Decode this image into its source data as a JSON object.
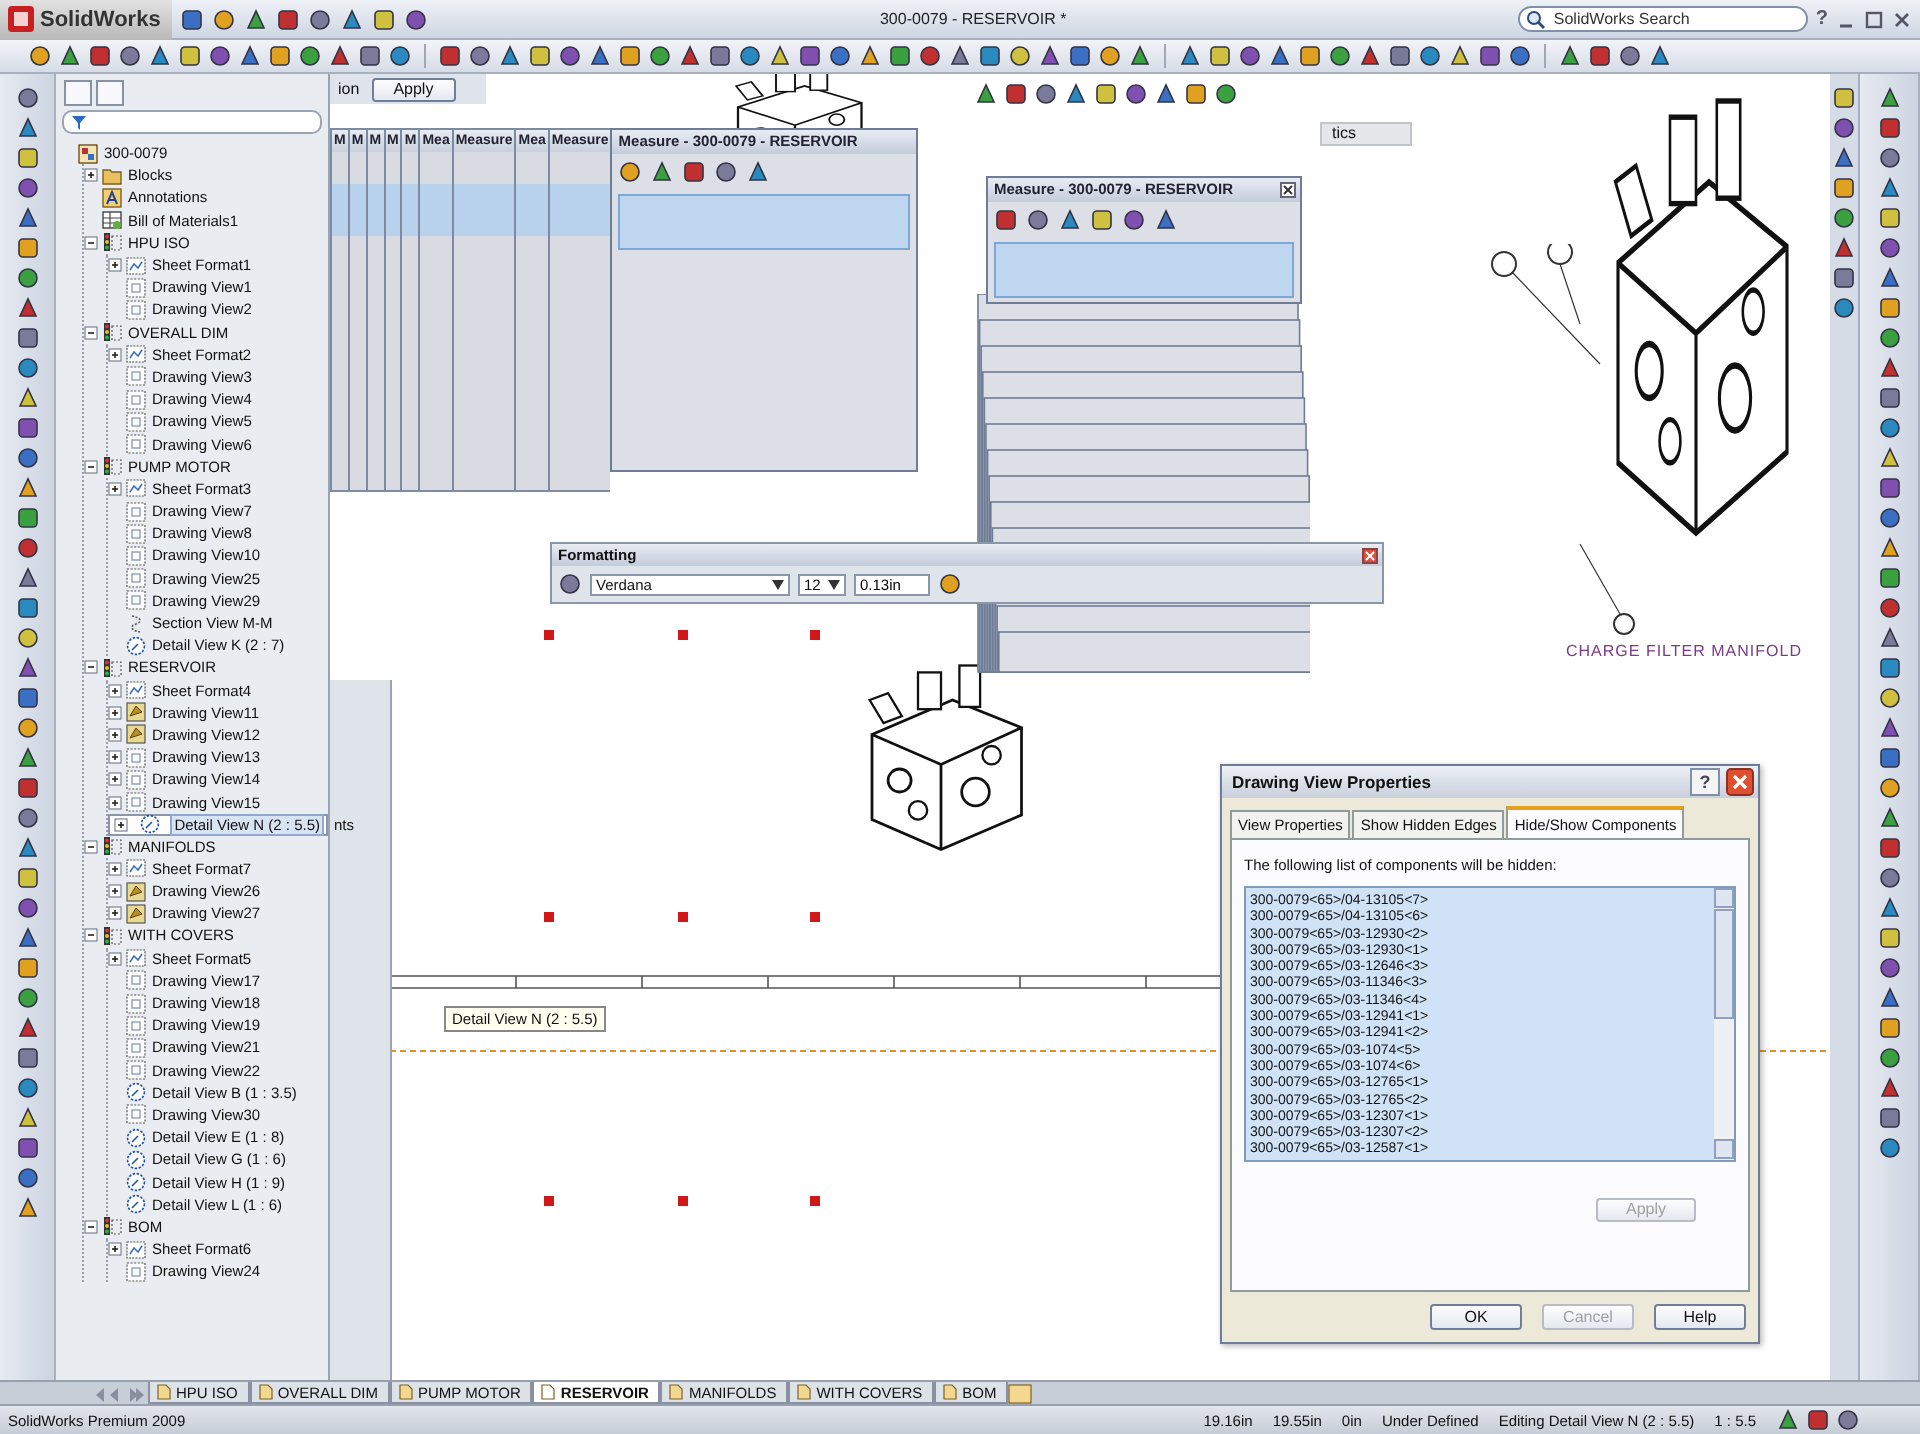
{
  "title_bar": {
    "logo": "SolidWorks",
    "document_title": "300-0079 - RESERVOIR *",
    "search": {
      "placeholder": "SolidWorks Search"
    },
    "help_glyph": "?"
  },
  "property_panel": {
    "label": "ion",
    "apply": "Apply"
  },
  "feature_tree": {
    "items": [
      {
        "label": "300-0079",
        "kind": "drawing",
        "selected": false,
        "children": [
          {
            "label": "Blocks",
            "kind": "folder",
            "expanded": false,
            "selected": false
          },
          {
            "label": "Annotations",
            "kind": "annotations",
            "selected": false
          },
          {
            "label": "Bill of Materials1",
            "kind": "bom",
            "selected": false
          },
          {
            "label": "HPU ISO",
            "kind": "sheet",
            "expanded": true,
            "selected": false,
            "children": [
              {
                "label": "Sheet Format1",
                "kind": "format",
                "expanded": false,
                "selected": false
              },
              {
                "label": "Drawing View1",
                "kind": "view",
                "selected": false
              },
              {
                "label": "Drawing View2",
                "kind": "view",
                "selected": false
              }
            ]
          },
          {
            "label": "OVERALL DIM",
            "kind": "sheet",
            "expanded": true,
            "selected": false,
            "children": [
              {
                "label": "Sheet Format2",
                "kind": "format",
                "expanded": false,
                "selected": false
              },
              {
                "label": "Drawing View3",
                "kind": "view",
                "selected": false
              },
              {
                "label": "Drawing View4",
                "kind": "view",
                "selected": false
              },
              {
                "label": "Drawing View5",
                "kind": "view",
                "selected": false
              },
              {
                "label": "Drawing View6",
                "kind": "view",
                "selected": false
              }
            ]
          },
          {
            "label": "PUMP MOTOR",
            "kind": "sheet",
            "expanded": true,
            "selected": false,
            "children": [
              {
                "label": "Sheet Format3",
                "kind": "format",
                "expanded": false,
                "selected": false
              },
              {
                "label": "Drawing View7",
                "kind": "view",
                "selected": false
              },
              {
                "label": "Drawing View8",
                "kind": "view",
                "selected": false
              },
              {
                "label": "Drawing View10",
                "kind": "view",
                "selected": false
              },
              {
                "label": "Drawing View25",
                "kind": "view",
                "selected": false
              },
              {
                "label": "Drawing View29",
                "kind": "view",
                "selected": false
              },
              {
                "label": "Section View M-M",
                "kind": "section",
                "selected": false
              },
              {
                "label": "Detail View K (2 : 7)",
                "kind": "detail",
                "selected": false
              }
            ]
          },
          {
            "label": "RESERVOIR",
            "kind": "sheet",
            "expanded": true,
            "selected": false,
            "children": [
              {
                "label": "Sheet Format4",
                "kind": "format",
                "expanded": false,
                "selected": false
              },
              {
                "label": "Drawing View11",
                "kind": "model",
                "expanded": false,
                "selected": false
              },
              {
                "label": "Drawing View12",
                "kind": "model",
                "expanded": false,
                "selected": false
              },
              {
                "label": "Drawing View13",
                "kind": "view",
                "expanded": false,
                "selected": false
              },
              {
                "label": "Drawing View14",
                "kind": "view",
                "expanded": false,
                "selected": false
              },
              {
                "label": "Drawing View15",
                "kind": "view",
                "expanded": false,
                "selected": false
              },
              {
                "label": "Detail View N (2 : 5.5)",
                "kind": "detail",
                "expanded": false,
                "selected": true
              }
            ]
          },
          {
            "label": "MANIFOLDS",
            "kind": "sheet",
            "expanded": true,
            "selected": false,
            "children": [
              {
                "label": "Sheet Format7",
                "kind": "format",
                "expanded": false,
                "selected": false
              },
              {
                "label": "Drawing View26",
                "kind": "model",
                "expanded": false,
                "selected": false
              },
              {
                "label": "Drawing View27",
                "kind": "model",
                "expanded": false,
                "selected": false
              }
            ]
          },
          {
            "label": "WITH COVERS",
            "kind": "sheet",
            "expanded": true,
            "selected": false,
            "children": [
              {
                "label": "Sheet Format5",
                "kind": "format",
                "expanded": false,
                "selected": false
              },
              {
                "label": "Drawing View17",
                "kind": "view",
                "selected": false
              },
              {
                "label": "Drawing View18",
                "kind": "view",
                "selected": false
              },
              {
                "label": "Drawing View19",
                "kind": "view",
                "selected": false
              },
              {
                "label": "Drawing View21",
                "kind": "view",
                "selected": false
              },
              {
                "label": "Drawing View22",
                "kind": "view",
                "selected": false
              },
              {
                "label": "Detail View B (1 : 3.5)",
                "kind": "detail",
                "selected": false
              },
              {
                "label": "Drawing View30",
                "kind": "view",
                "selected": false
              },
              {
                "label": "Detail View E (1 : 8)",
                "kind": "detail",
                "selected": false
              },
              {
                "label": "Detail View G (1 : 6)",
                "kind": "detail",
                "selected": false
              },
              {
                "label": "Detail View H (1 : 9)",
                "kind": "detail",
                "selected": false
              },
              {
                "label": "Detail View L (1 : 6)",
                "kind": "detail",
                "selected": false
              }
            ]
          },
          {
            "label": "BOM",
            "kind": "sheet",
            "expanded": true,
            "selected": false,
            "children": [
              {
                "label": "Sheet Format6",
                "kind": "format",
                "expanded": false,
                "selected": false
              },
              {
                "label": "Drawing View24",
                "kind": "view",
                "selected": false
              }
            ]
          }
        ]
      }
    ]
  },
  "measure_stack": [
    {
      "title": "M"
    },
    {
      "title": "M"
    },
    {
      "title": "M"
    },
    {
      "title": "M"
    },
    {
      "title": "M"
    },
    {
      "title": "Mea"
    },
    {
      "title": "Measure"
    },
    {
      "title": "Mea"
    },
    {
      "title": "Measure"
    }
  ],
  "measure_windows": [
    {
      "title": "Measure - 300-0079 - RESERVOIR"
    },
    {
      "title": "Measure - 300-0079 - RESERVOIR"
    }
  ],
  "hidden_panel": {
    "label": "tics"
  },
  "side_panel": {
    "label": "nts"
  },
  "formatting": {
    "title": "Formatting",
    "font": "Verdana",
    "size": "12",
    "height": "0.13in"
  },
  "drawing": {
    "label": "CHARGE FILTER MANIFOLD",
    "tooltip": "Detail View N (2 : 5.5)"
  },
  "dialog": {
    "title": "Drawing View Properties",
    "help_glyph": "?",
    "tabs": [
      {
        "label": "View Properties",
        "selected": false
      },
      {
        "label": "Show Hidden Edges",
        "selected": false
      },
      {
        "label": "Hide/Show Components",
        "selected": true
      }
    ],
    "prompt": "The following list of components will be hidden:",
    "components": [
      "300-0079<65>/04-13105<7>",
      "300-0079<65>/04-13105<6>",
      "300-0079<65>/03-12930<2>",
      "300-0079<65>/03-12930<1>",
      "300-0079<65>/03-12646<3>",
      "300-0079<65>/03-11346<3>",
      "300-0079<65>/03-11346<4>",
      "300-0079<65>/03-12941<1>",
      "300-0079<65>/03-12941<2>",
      "300-0079<65>/03-1074<5>",
      "300-0079<65>/03-1074<6>",
      "300-0079<65>/03-12765<1>",
      "300-0079<65>/03-12765<2>",
      "300-0079<65>/03-12307<1>",
      "300-0079<65>/03-12307<2>",
      "300-0079<65>/03-12587<1>"
    ],
    "apply": {
      "label": "Apply",
      "disabled": true
    },
    "buttons": [
      {
        "label": "OK",
        "disabled": false
      },
      {
        "label": "Cancel",
        "disabled": true
      },
      {
        "label": "Help",
        "disabled": false
      }
    ]
  },
  "sheet_tabs": [
    {
      "label": "HPU ISO",
      "selected": false
    },
    {
      "label": "OVERALL DIM",
      "selected": false
    },
    {
      "label": "PUMP MOTOR",
      "selected": false
    },
    {
      "label": "RESERVOIR",
      "selected": true
    },
    {
      "label": "MANIFOLDS",
      "selected": false
    },
    {
      "label": "WITH COVERS",
      "selected": false
    },
    {
      "label": "BOM",
      "selected": false
    }
  ],
  "status_bar": {
    "product": "SolidWorks Premium 2009",
    "fields": [
      "19.16in",
      "19.55in",
      "0in",
      "Under Defined",
      "Editing Detail View N (2 : 5.5)",
      "1 : 5.5"
    ]
  }
}
